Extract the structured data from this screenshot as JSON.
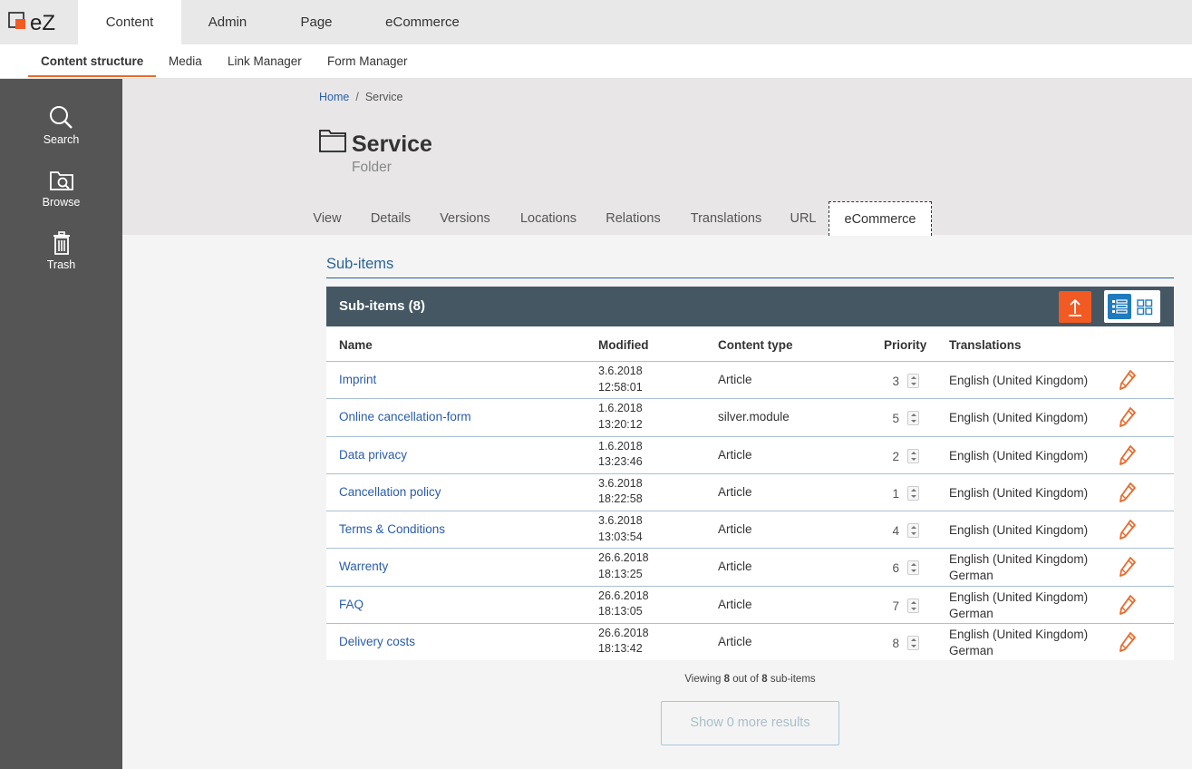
{
  "topnav": {
    "logo_text": "eZ",
    "tabs": [
      "Content",
      "Admin",
      "Page",
      "eCommerce"
    ],
    "active_tab": "Content"
  },
  "subnav": {
    "tabs": [
      "Content structure",
      "Media",
      "Link Manager",
      "Form Manager"
    ],
    "active_tab": "Content structure"
  },
  "sidebar": {
    "items": [
      {
        "label": "Search",
        "icon": "search-icon"
      },
      {
        "label": "Browse",
        "icon": "browse-icon"
      },
      {
        "label": "Trash",
        "icon": "trash-icon"
      }
    ]
  },
  "breadcrumb": {
    "home": "Home",
    "separator": "/",
    "current": "Service"
  },
  "header": {
    "title": "Service",
    "content_type": "Folder",
    "icon": "folder-icon"
  },
  "content_tabs": {
    "tabs": [
      "View",
      "Details",
      "Versions",
      "Locations",
      "Relations",
      "Translations",
      "URL",
      "eCommerce"
    ],
    "active_tab": "eCommerce"
  },
  "subitems": {
    "section_title": "Sub-items",
    "panel_title": "Sub-items (8)",
    "columns": [
      "Name",
      "Modified",
      "Content type",
      "Priority",
      "Translations"
    ],
    "rows": [
      {
        "name": "Imprint",
        "modified_date": "3.6.2018",
        "modified_time": "12:58:01",
        "content_type": "Article",
        "priority": "3",
        "translations": [
          "English (United Kingdom)"
        ]
      },
      {
        "name": "Online cancellation-form",
        "modified_date": "1.6.2018",
        "modified_time": "13:20:12",
        "content_type": "silver.module",
        "priority": "5",
        "translations": [
          "English (United Kingdom)"
        ]
      },
      {
        "name": "Data privacy",
        "modified_date": "1.6.2018",
        "modified_time": "13:23:46",
        "content_type": "Article",
        "priority": "2",
        "translations": [
          "English (United Kingdom)"
        ]
      },
      {
        "name": "Cancellation policy",
        "modified_date": "3.6.2018",
        "modified_time": "18:22:58",
        "content_type": "Article",
        "priority": "1",
        "translations": [
          "English (United Kingdom)"
        ]
      },
      {
        "name": "Terms & Conditions",
        "modified_date": "3.6.2018",
        "modified_time": "13:03:54",
        "content_type": "Article",
        "priority": "4",
        "translations": [
          "English (United Kingdom)"
        ]
      },
      {
        "name": "Warrenty",
        "modified_date": "26.6.2018",
        "modified_time": "18:13:25",
        "content_type": "Article",
        "priority": "6",
        "translations": [
          "English (United Kingdom)",
          "German"
        ]
      },
      {
        "name": "FAQ",
        "modified_date": "26.6.2018",
        "modified_time": "18:13:05",
        "content_type": "Article",
        "priority": "7",
        "translations": [
          "English (United Kingdom)",
          "German"
        ]
      },
      {
        "name": "Delivery costs",
        "modified_date": "26.6.2018",
        "modified_time": "18:13:42",
        "content_type": "Article",
        "priority": "8",
        "translations": [
          "English (United Kingdom)",
          "German"
        ]
      }
    ],
    "viewing": {
      "prefix": "Viewing",
      "shown": "8",
      "middle": "out of",
      "total": "8",
      "suffix": "sub-items"
    },
    "more_button": "Show 0 more results"
  },
  "colors": {
    "accent_orange": "#f15a22",
    "panel_header": "#445763",
    "link_blue": "#2a5cad",
    "sidebar": "#555555"
  }
}
